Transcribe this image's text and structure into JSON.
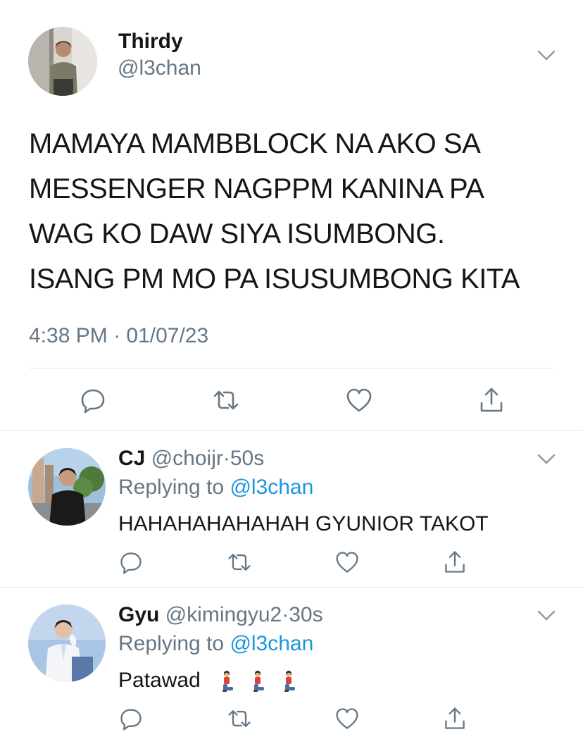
{
  "main_tweet": {
    "name": "Thirdy",
    "handle": "@l3chan",
    "text_lines": [
      "MAMAYA MAMBBLOCK NA AKO SA",
      "MESSENGER NAGPPM KANINA PA",
      "WAG KO DAW SIYA ISUMBONG.",
      "ISANG PM MO PA ISUSUMBONG KITA"
    ],
    "timestamp": "4:38 PM · 01/07/23",
    "actions": [
      "reply-icon",
      "retweet-icon",
      "like-icon",
      "share-icon"
    ]
  },
  "replies": [
    {
      "name": "CJ",
      "handle": "@choijr",
      "dot": "·",
      "time": "50s",
      "replying_prefix": "Replying to ",
      "replying_to": "@l3chan",
      "text": "HAHAHAHAHAHAH GYUNIOR TAKOT"
    },
    {
      "name": "Gyu",
      "handle": "@kimingyu2",
      "dot": "·",
      "time": "30s",
      "replying_prefix": "Replying to ",
      "replying_to": "@l3chan",
      "text": "Patawad",
      "emojis": [
        "kneeling-person-emoji",
        "kneeling-person-emoji",
        "kneeling-person-emoji"
      ]
    }
  ],
  "colors": {
    "text": "#14171a",
    "secondary": "#657786",
    "link": "#1b95e0",
    "divider": "#e1e8ed"
  }
}
